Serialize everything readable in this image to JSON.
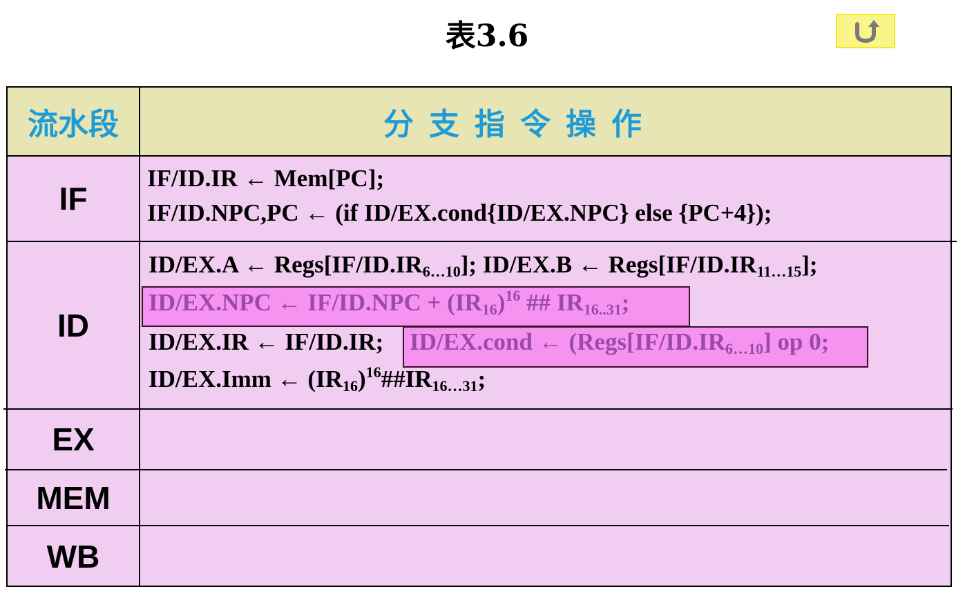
{
  "title": "表3.6",
  "back_icon": "return-arrow-icon",
  "header": {
    "stage": "流水段",
    "ops": "分支指令操作"
  },
  "rows": [
    {
      "stage": "IF"
    },
    {
      "stage": "ID"
    },
    {
      "stage": "EX"
    },
    {
      "stage": "MEM"
    },
    {
      "stage": "WB"
    }
  ],
  "if_lines": {
    "l1": "IF/ID.IR ← Mem[PC];",
    "l2": "IF/ID.NPC,PC ← (if ID/EX.cond{ID/EX.NPC} else {PC+4});"
  },
  "id_lines": {
    "l1": {
      "a": "ID/EX.A ← Regs[IF/ID.IR",
      "s1": "6…10",
      "b": "]; ID/EX.B ← Regs[IF/ID.IR",
      "s2": "11…15",
      "c": "];"
    },
    "l2": {
      "a": "ID/EX.NPC ← IF/ID.NPC + (IR",
      "s1": "16",
      "b": ")",
      "sup": "16",
      "c": " ## IR",
      "s2": "16..31",
      "d": ";"
    },
    "l3": {
      "a": "ID/EX.IR ← IF/ID.IR;",
      "b": "ID/EX.cond ← (Regs[IF/ID.IR",
      "s1": "6…10",
      "c": "] op 0;"
    },
    "l4": {
      "a": "ID/EX.Imm ← (IR",
      "s1": "16",
      "b": ")",
      "sup": "16",
      "c": "##IR",
      "s2": "16…31",
      "d": ";"
    }
  },
  "colors": {
    "header_bg": "#e7e5b4",
    "body_bg": "#f2cdf2",
    "header_text": "#1e9bd7",
    "highlight_box": "#f693f0",
    "highlight_text": "#9b4aa6",
    "button_bg": "#f9f58a"
  }
}
